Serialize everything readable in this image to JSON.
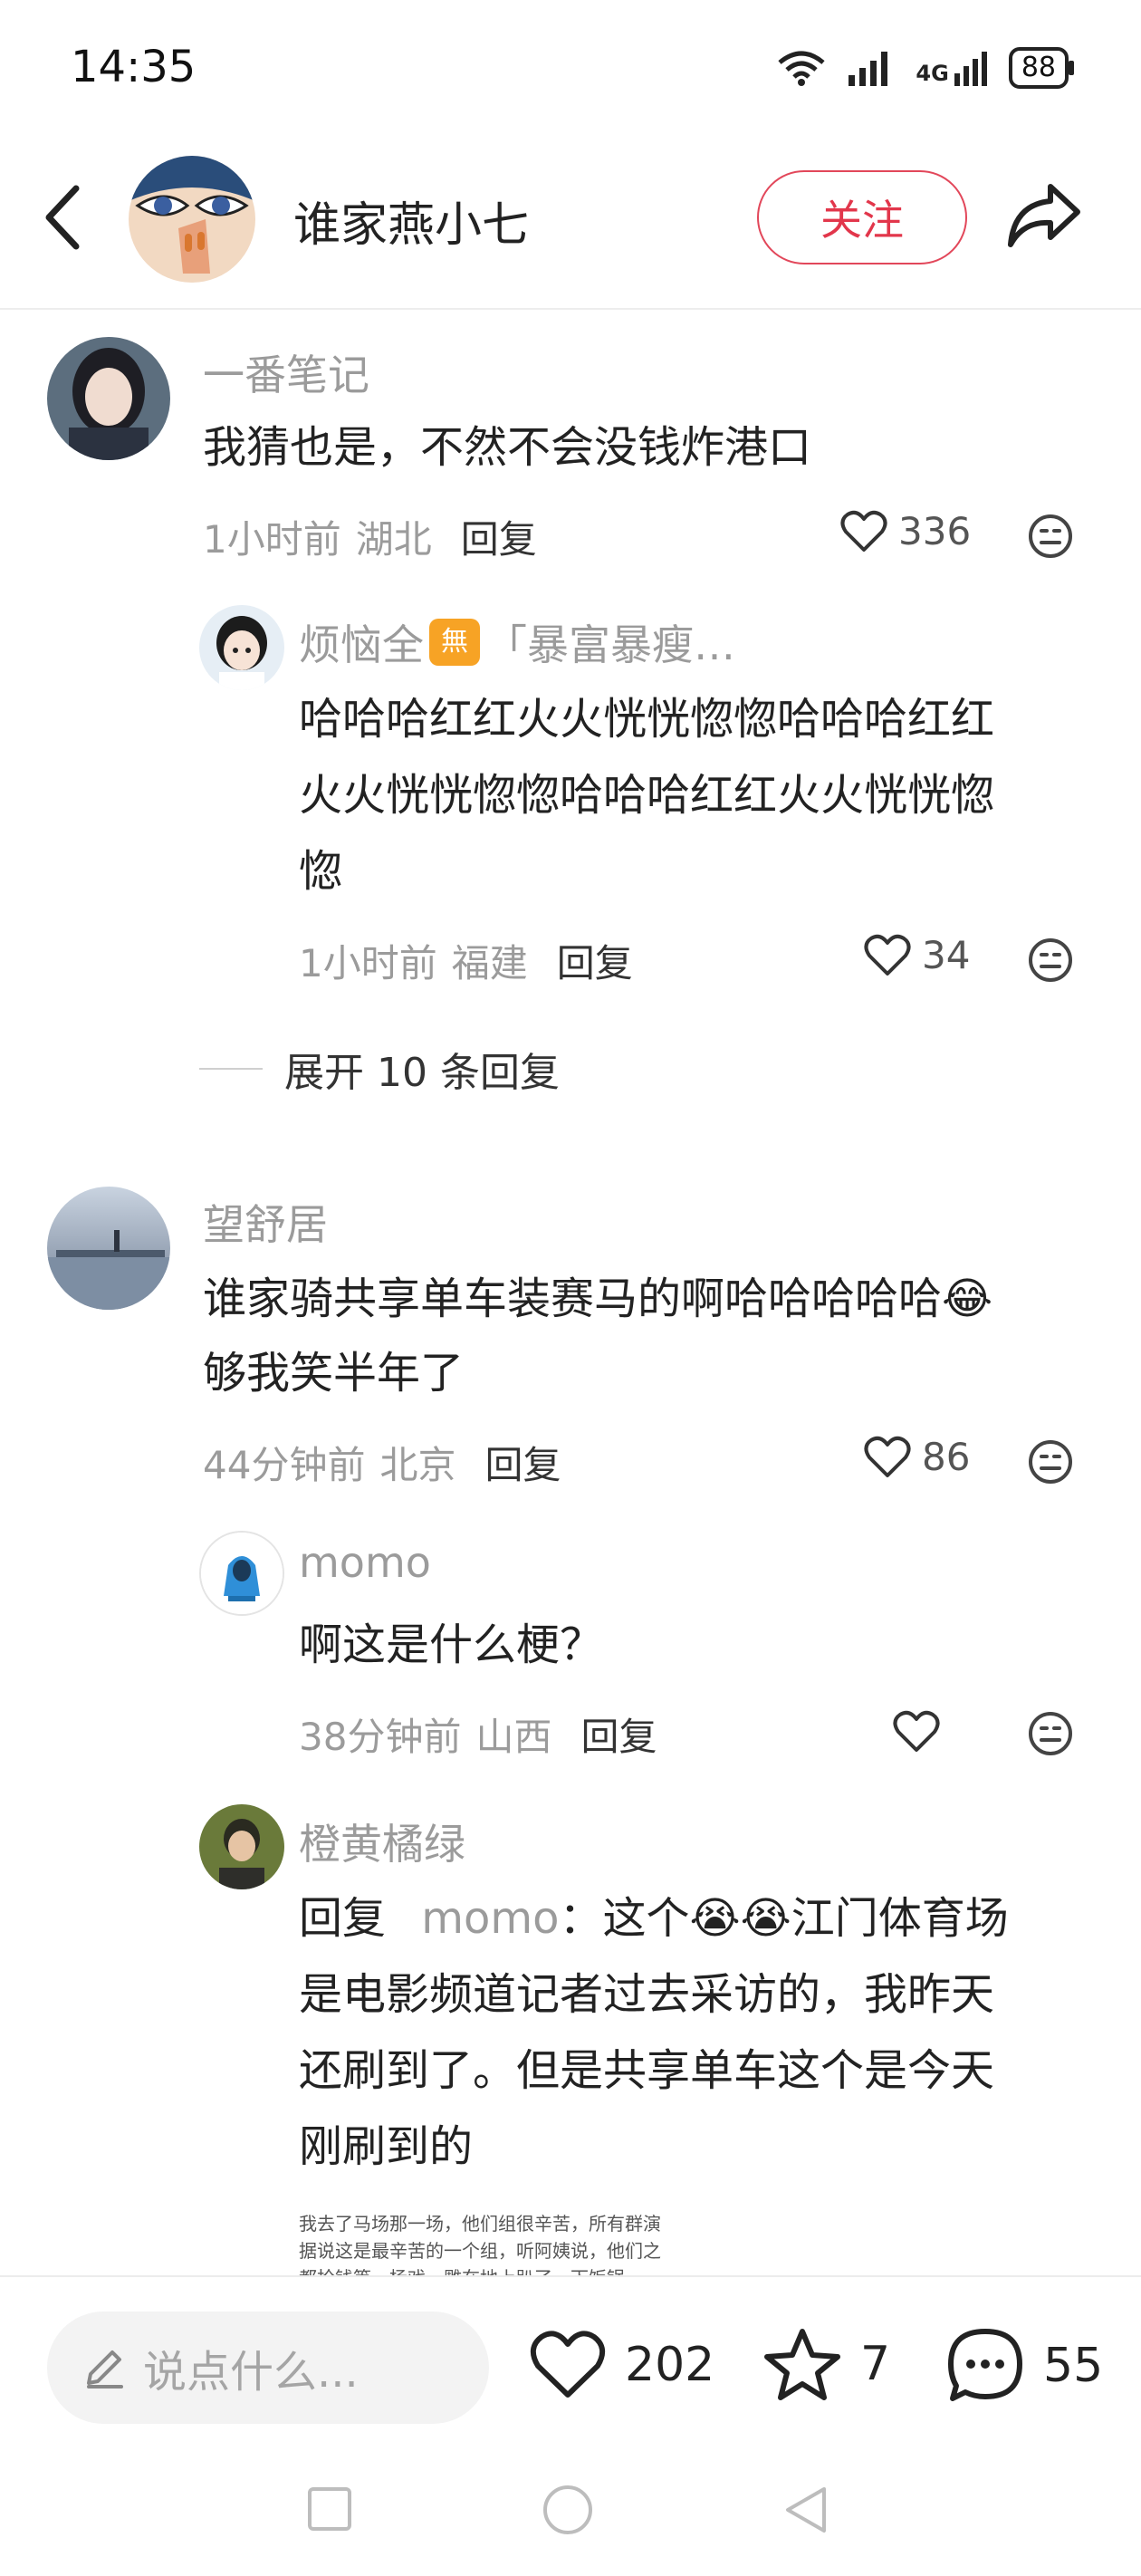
{
  "status_bar": {
    "time": "14:35",
    "network": "4G",
    "battery": "88"
  },
  "header": {
    "title": "谁家燕小七",
    "follow_label": "关注"
  },
  "comments": [
    {
      "user": "一番笔记",
      "text": "我猜也是，不然不会没钱炸港口",
      "time": "1小时前",
      "location": "湖北",
      "reply_label": "回复",
      "likes": "336",
      "replies": [
        {
          "user": "烦恼全",
          "badge": "無",
          "tag": "「暴富暴瘦…",
          "text_lines": [
            "哈哈哈红红火火恍恍惚惚哈哈哈红红",
            "火火恍恍惚惚哈哈哈红红火火恍恍惚",
            "惚"
          ],
          "time": "1小时前",
          "location": "福建",
          "reply_label": "回复",
          "likes": "34"
        }
      ],
      "expand_label": "展开 10 条回复"
    },
    {
      "user": "望舒居",
      "text_lines": [
        "谁家骑共享单车装赛马的啊哈哈哈哈哈😂",
        "够我笑半年了"
      ],
      "time": "44分钟前",
      "location": "北京",
      "reply_label": "回复",
      "likes": "86",
      "replies": [
        {
          "user": "momo",
          "text": "啊这是什么梗？",
          "time": "38分钟前",
          "location": "山西",
          "reply_label": "回复",
          "likes": ""
        },
        {
          "user": "橙黄橘绿",
          "reply_prefix": "回复",
          "reply_to": "momo",
          "text_lines": [
            "：这个😭😭江门体育场",
            "是电影频道记者过去采访的，我昨天",
            "还刷到了。但是共享单车这个是今天",
            "刚刷到的"
          ],
          "image_text_lines": [
            "我去了马场那一场，他们组很辛苦，所有群演",
            "据说这是最辛苦的一个组，听阿姨说，他们之",
            "都抢钱等，杨戏，雕在地上趴了，下饭锅"
          ]
        }
      ]
    }
  ],
  "bottom_bar": {
    "input_placeholder": "说点什么...",
    "likes": "202",
    "stars": "7",
    "comments": "55"
  },
  "colors": {
    "accent": "#e2364b",
    "muted": "#9b9b9b",
    "badge": "#f7a325"
  }
}
